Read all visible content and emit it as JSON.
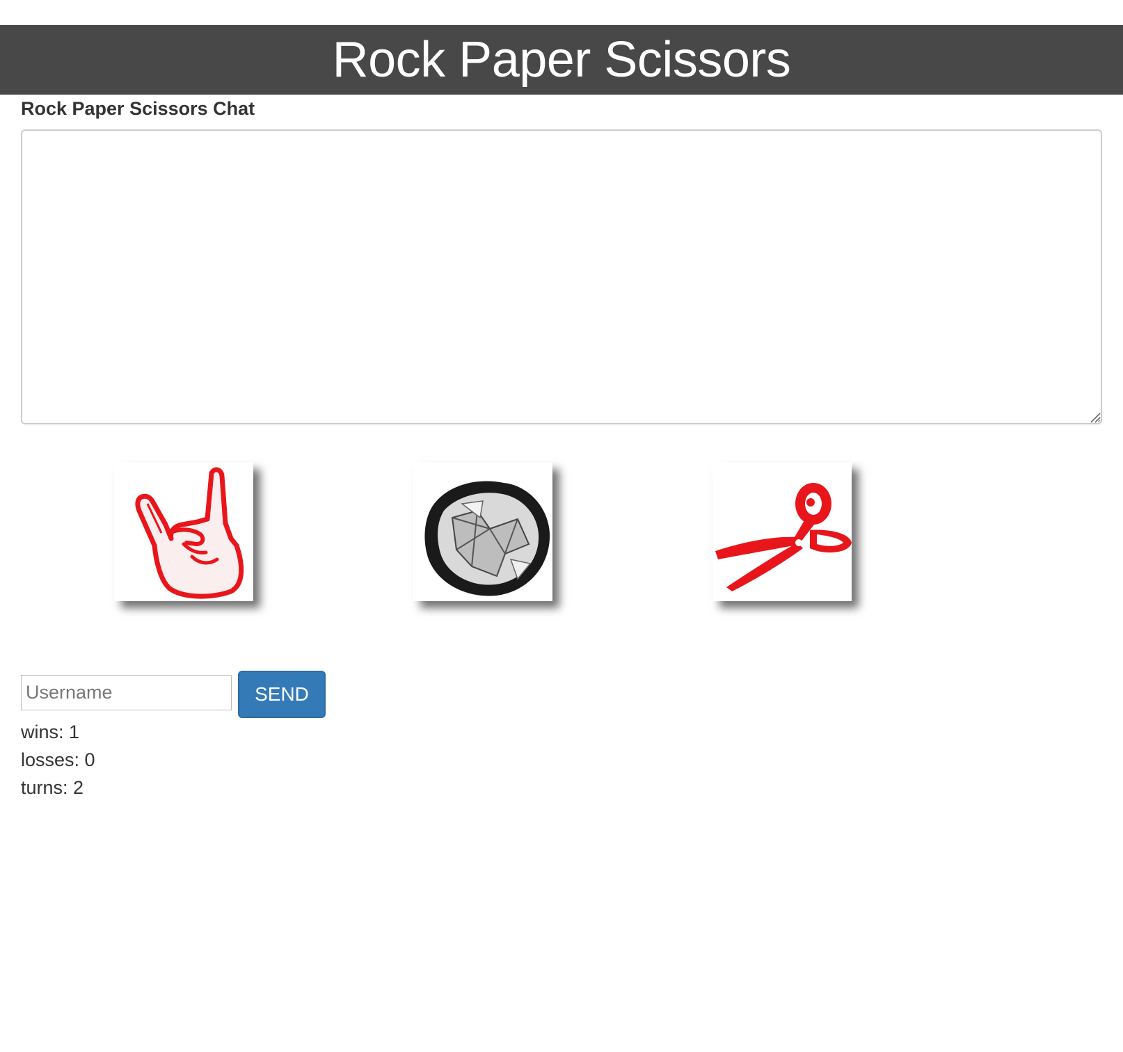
{
  "header": {
    "title": "Rock Paper Scissors"
  },
  "chat": {
    "label": "Rock Paper Scissors Chat",
    "content": ""
  },
  "choices": [
    {
      "name": "rock",
      "icon": "rock-hand-icon",
      "color": "#e8161b"
    },
    {
      "name": "paper",
      "icon": "crumpled-paper-icon",
      "color": "#111111"
    },
    {
      "name": "scissors",
      "icon": "scissors-icon",
      "color": "#e8161b"
    }
  ],
  "form": {
    "username_placeholder": "Username",
    "username_value": "",
    "send_label": "SEND",
    "send_color": "#337ab7"
  },
  "stats": {
    "wins": "wins: 1",
    "losses": "losses: 0",
    "turns": "turns: 2"
  }
}
